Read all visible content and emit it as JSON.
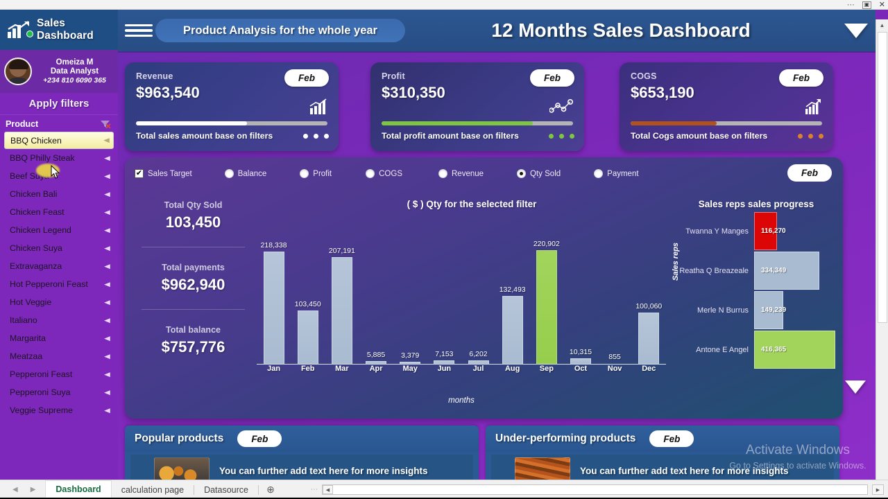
{
  "window": {
    "controls": {
      "more": "···",
      "restore": "restore-icon",
      "close": "✕"
    }
  },
  "brand": {
    "title": "Sales Dashboard",
    "logo_icon": "bar-chart-growth-icon"
  },
  "profile": {
    "name": "Omeiza M",
    "role": "Data Analyst",
    "phone": "+234 810 6090 365",
    "avatar_icon": "user-avatar",
    "status_icon": "online-dot-icon"
  },
  "sidebar": {
    "apply_filters_label": "Apply filters",
    "product_label": "Product",
    "clear_filter_icon": "clear-filter-icon",
    "items": [
      {
        "label": "BBQ Chicken",
        "selected": true
      },
      {
        "label": "BBQ Philly Steak",
        "selected": false
      },
      {
        "label": "Beef Suya",
        "selected": false
      },
      {
        "label": "Chicken Bali",
        "selected": false
      },
      {
        "label": "Chicken Feast",
        "selected": false
      },
      {
        "label": "Chicken Legend",
        "selected": false
      },
      {
        "label": "Chicken Suya",
        "selected": false
      },
      {
        "label": "Extravaganza",
        "selected": false
      },
      {
        "label": "Hot Pepperoni Feast",
        "selected": false
      },
      {
        "label": "Hot Veggie",
        "selected": false
      },
      {
        "label": "Italiano",
        "selected": false
      },
      {
        "label": "Margarita",
        "selected": false
      },
      {
        "label": "Meatzaa",
        "selected": false
      },
      {
        "label": "Pepperoni Feast",
        "selected": false
      },
      {
        "label": "Pepperoni Suya",
        "selected": false
      },
      {
        "label": "Veggie Supreme",
        "selected": false
      }
    ]
  },
  "header": {
    "menu_icon": "hamburger-menu-icon",
    "pill_title": "Product Analysis for the whole year",
    "dashboard_title": "12 Months Sales Dashboard",
    "caret_icon": "chevron-down-icon"
  },
  "kpis": [
    {
      "label": "Revenue",
      "value": "$963,540",
      "pill": "Feb",
      "footer": "Total sales amount base on filters",
      "icon": "bar-chart-icon",
      "progress_pct": 58,
      "color": "#ffffff"
    },
    {
      "label": "Profit",
      "value": "$310,350",
      "pill": "Feb",
      "footer": "Total profit amount base on filters",
      "icon": "line-chart-nodes-icon",
      "progress_pct": 79,
      "color": "#7ec63f"
    },
    {
      "label": "COGS",
      "value": "$653,190",
      "pill": "Feb",
      "footer": "Total Cogs amount base on filters",
      "icon": "trend-up-bars-icon",
      "progress_pct": 45,
      "color": "#b0521b"
    }
  ],
  "filters": {
    "pill": "Feb",
    "options": [
      {
        "label": "Sales Target",
        "type": "checkbox",
        "checked": true
      },
      {
        "label": "Balance",
        "type": "radio",
        "checked": false
      },
      {
        "label": "Profit",
        "type": "radio",
        "checked": false
      },
      {
        "label": "COGS",
        "type": "radio",
        "checked": false
      },
      {
        "label": "Revenue",
        "type": "radio",
        "checked": false
      },
      {
        "label": "Qty Sold",
        "type": "radio",
        "checked": true
      },
      {
        "label": "Payment",
        "type": "radio",
        "checked": false
      }
    ]
  },
  "stats": [
    {
      "label": "Total Qty Sold",
      "value": "103,450"
    },
    {
      "label": "Total payments",
      "value": "$962,940"
    },
    {
      "label": "Total balance",
      "value": "$757,776"
    }
  ],
  "chart_data": [
    {
      "type": "bar",
      "title": "( $ )  Qty for the selected filter",
      "xlabel": "months",
      "ylabel": "",
      "grid": false,
      "highlight_category": "Sep",
      "highlight_color": "#9ace4f",
      "bar_color": "#aebfd4",
      "categories": [
        "Jan",
        "Feb",
        "Mar",
        "Apr",
        "May",
        "Jun",
        "Jul",
        "Aug",
        "Sep",
        "Oct",
        "Nov",
        "Dec"
      ],
      "values": [
        218338,
        103450,
        207191,
        5885,
        3379,
        7153,
        6202,
        132493,
        220902,
        10315,
        855,
        100060
      ],
      "labels": [
        "218,338",
        "103,450",
        "207,191",
        "5,885",
        "3,379",
        "7,153",
        "6,202",
        "132,493",
        "220,902",
        "10,315",
        "855",
        "100,060"
      ],
      "ylim": [
        0,
        240000
      ]
    },
    {
      "type": "bar",
      "orientation": "horizontal",
      "title": "Sales reps sales progress",
      "ylabel": "Sales reps",
      "xlabel": "",
      "categories": [
        "Twanna Y Manges",
        "Reatha Q Breazeale",
        "Merle N Burrus",
        "Antone E Angel"
      ],
      "values": [
        116270,
        334349,
        149239,
        416365
      ],
      "labels": [
        "116,270",
        "334,349",
        "149,239",
        "416,365"
      ],
      "colors": [
        "#dd0606",
        "#a9bbd1",
        "#a9bbd1",
        "#a2d45c"
      ],
      "xlim": [
        0,
        420000
      ]
    }
  ],
  "bottom_panels": [
    {
      "title": "Popular products",
      "pill": "Feb",
      "row_text": "You can further add text here for more insights",
      "thumb_icon": "fried-chicken-photo"
    },
    {
      "title": "Under-performing products",
      "pill": "Feb",
      "row_text": "You can further add text here for more insights",
      "thumb_icon": "grilled-skewers-photo"
    }
  ],
  "watermark": {
    "line1": "Activate Windows",
    "line2": "Go to Settings to activate Windows."
  },
  "status_bar": {
    "prev_icon": "chevron-left-icon",
    "next_icon": "chevron-right-icon",
    "tabs": [
      {
        "label": "Dashboard",
        "active": true
      },
      {
        "label": "calculation page",
        "active": false
      },
      {
        "label": "Datasource",
        "active": false
      }
    ],
    "add_sheet_icon": "plus-circle-icon",
    "hscroll_left_icon": "scroll-left-icon",
    "hscroll_right_icon": "scroll-right-icon"
  }
}
